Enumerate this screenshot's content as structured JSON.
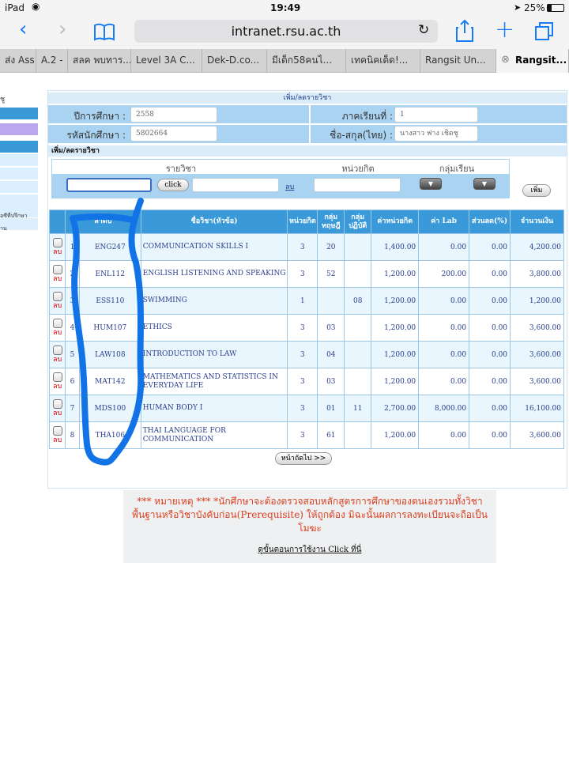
{
  "status": {
    "device": "iPad",
    "time": "19:49",
    "battery": "25%"
  },
  "browser": {
    "url": "intranet.rsu.ac.th"
  },
  "tabs": [
    "ส่ง Ass",
    "A.2 -",
    "สลค พบทาร...",
    "Level 3A C...",
    "Dek-D.co...",
    "มีเด็ก58คนไ...",
    "เทคนิคเด็ด!...",
    "Rangsit Un...",
    "Rangsit..."
  ],
  "sidebar": {
    "text1": "ชู",
    "text2": "อซีที่ปรึกษา",
    "text3": "าน"
  },
  "header": {
    "title": "เพิ่ม/ลดรายวิชา"
  },
  "info": {
    "year_label": "ปีการศึกษา :",
    "year_value": "2558",
    "term_label": "ภาคเรียนที่ :",
    "term_value": "1",
    "student_label": "รหัสนักศึกษา :",
    "student_value": "5802664",
    "name_label": "ชื่อ-สกุล(ไทย) :",
    "name_value": "นางสาว ฟาง เชิดชู"
  },
  "add_section": {
    "title": "เพิ่ม/ลดรายวิชา",
    "col_course": "รายวิชา",
    "col_credit": "หน่วยกิต",
    "col_group": "กลุ่มเรียน",
    "click_label": "click",
    "del_label": "ลบ",
    "add_label": "เพิ่ม"
  },
  "table": {
    "headers": [
      "ลำดับ",
      "",
      "ชื่อวิชา(หัวข้อ)",
      "หน่วยกิต",
      "กลุ่ม ทฤษฎี",
      "กลุ่ม ปฏิบัติ",
      "ค่าหน่วยกิต",
      "ค่า Lab",
      "ส่วนลด(%)",
      "จำนวนเงิน"
    ],
    "del_label": "ลบ",
    "rows": [
      {
        "no": "1",
        "code": "ENG247",
        "name": "COMMUNICATION SKILLS I",
        "credit": "3",
        "theory": "20",
        "practice": "",
        "fee": "1,400.00",
        "lab": "0.00",
        "discount": "0.00",
        "amount": "4,200.00"
      },
      {
        "no": "2",
        "code": "ENL112",
        "name": "ENGLISH LISTENING AND SPEAKING",
        "credit": "3",
        "theory": "52",
        "practice": "",
        "fee": "1,200.00",
        "lab": "200.00",
        "discount": "0.00",
        "amount": "3,800.00"
      },
      {
        "no": "3",
        "code": "ESS110",
        "name": "SWIMMING",
        "credit": "1",
        "theory": "",
        "practice": "08",
        "fee": "1,200.00",
        "lab": "0.00",
        "discount": "0.00",
        "amount": "1,200.00"
      },
      {
        "no": "4",
        "code": "HUM107",
        "name": "ETHICS",
        "credit": "3",
        "theory": "03",
        "practice": "",
        "fee": "1,200.00",
        "lab": "0.00",
        "discount": "0.00",
        "amount": "3,600.00"
      },
      {
        "no": "5",
        "code": "LAW108",
        "name": "INTRODUCTION TO LAW",
        "credit": "3",
        "theory": "04",
        "practice": "",
        "fee": "1,200.00",
        "lab": "0.00",
        "discount": "0.00",
        "amount": "3,600.00"
      },
      {
        "no": "6",
        "code": "MAT142",
        "name": "MATHEMATICS AND STATISTICS IN EVERYDAY LIFE",
        "credit": "3",
        "theory": "03",
        "practice": "",
        "fee": "1,200.00",
        "lab": "0.00",
        "discount": "0.00",
        "amount": "3,600.00"
      },
      {
        "no": "7",
        "code": "MDS100",
        "name": "HUMAN BODY I",
        "credit": "3",
        "theory": "01",
        "practice": "11",
        "fee": "2,700.00",
        "lab": "8,000.00",
        "discount": "0.00",
        "amount": "16,100.00"
      },
      {
        "no": "8",
        "code": "THA106",
        "name": "THAI LANGUAGE FOR COMMUNICATION",
        "credit": "3",
        "theory": "61",
        "practice": "",
        "fee": "1,200.00",
        "lab": "0.00",
        "discount": "0.00",
        "amount": "3,600.00"
      }
    ]
  },
  "next_button": "หน้าถัดไป >>",
  "note": {
    "line1": "*** หมายเหตุ *** *นักศึกษาจะต้องตรวจสอบหลักสูตรการศึกษาของตนเองรวมทั้งวิชา",
    "line2": "พื้นฐานหรือวิชาบังคับก่อน(Prerequisite) ให้ถูกต้อง มิฉะนั้นผลการลงทะเบียนจะถือเป็น",
    "line3": "โมฆะ",
    "link": "ดูขั้นตอนการใช้งาน Click ที่นี่"
  },
  "colors": {
    "header_blue": "#3a9ad9",
    "info_blue": "#a9d3f0",
    "note_red": "#d9401f",
    "highlight_stroke": "#1273e6"
  }
}
